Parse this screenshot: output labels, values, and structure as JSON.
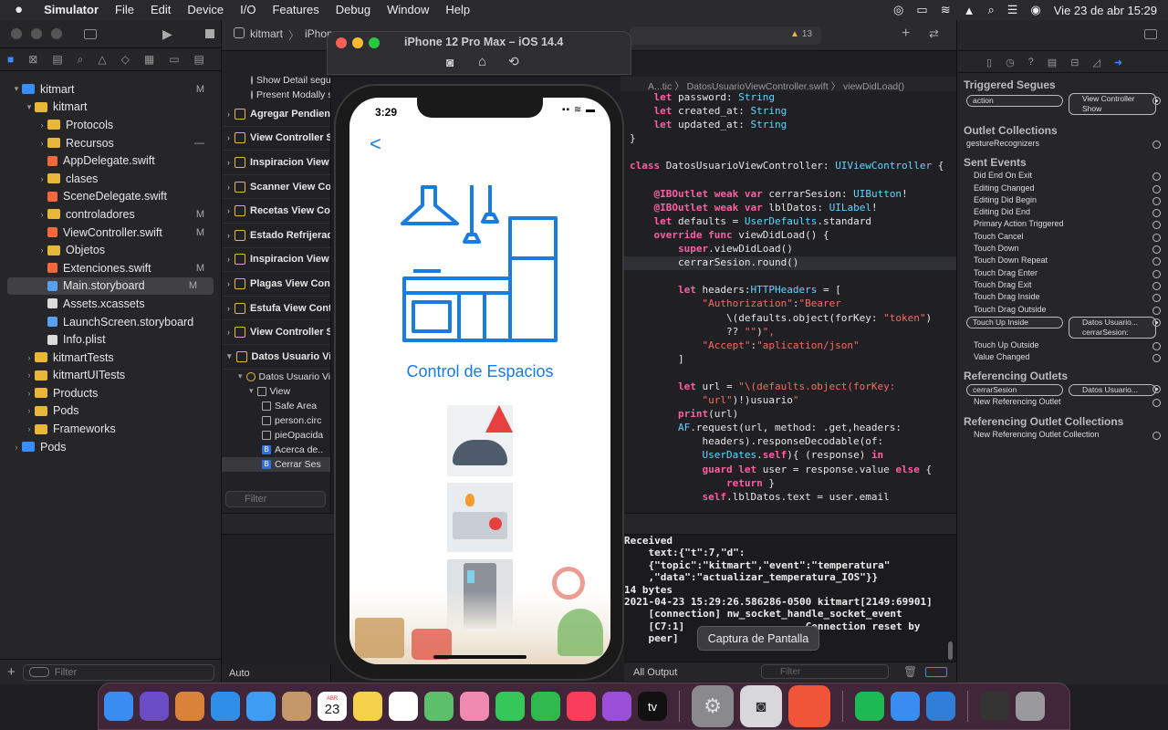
{
  "menubar": {
    "app": "Simulator",
    "items": [
      "File",
      "Edit",
      "Device",
      "I/O",
      "Features",
      "Debug",
      "Window",
      "Help"
    ],
    "datetime": "Vie 23 de abr  15:29"
  },
  "xcode": {
    "scheme": "kitmart",
    "scheme_dest": "iPhon",
    "warnings": "13",
    "storyboard_tab": "Ma",
    "breadcrumb_left": "kitmart",
    "breadcrumb_right": "A...tic",
    "breadcrumb_file": "DatosUsuarioViewController.swift",
    "breadcrumb_method": "viewDidLoad()",
    "nav_filter_placeholder": "Filter",
    "outline_filter_placeholder": "Filter",
    "zoom": "Auto",
    "console_filter": "All Output",
    "console_filter_placeholder": "Filter"
  },
  "navigator": {
    "tree": [
      {
        "label": "kitmart",
        "badge": "M",
        "level": 0,
        "icon": "project"
      },
      {
        "label": "kitmart",
        "badge": "",
        "level": 1,
        "icon": "folder"
      },
      {
        "label": "Protocols",
        "badge": "",
        "level": 2,
        "icon": "folder"
      },
      {
        "label": "Recursos",
        "badge": "—",
        "level": 2,
        "icon": "folder"
      },
      {
        "label": "AppDelegate.swift",
        "badge": "",
        "level": 2,
        "icon": "swift"
      },
      {
        "label": "clases",
        "badge": "",
        "level": 2,
        "icon": "folder"
      },
      {
        "label": "SceneDelegate.swift",
        "badge": "",
        "level": 2,
        "icon": "swift"
      },
      {
        "label": "controladores",
        "badge": "M",
        "level": 2,
        "icon": "folder"
      },
      {
        "label": "ViewController.swift",
        "badge": "M",
        "level": 2,
        "icon": "swift"
      },
      {
        "label": "Objetos",
        "badge": "",
        "level": 2,
        "icon": "folder"
      },
      {
        "label": "Extenciones.swift",
        "badge": "M",
        "level": 2,
        "icon": "swift"
      },
      {
        "label": "Main.storyboard",
        "badge": "M",
        "level": 2,
        "icon": "storyboard"
      },
      {
        "label": "Assets.xcassets",
        "badge": "",
        "level": 2,
        "icon": "file"
      },
      {
        "label": "LaunchScreen.storyboard",
        "badge": "",
        "level": 2,
        "icon": "storyboard"
      },
      {
        "label": "Info.plist",
        "badge": "",
        "level": 2,
        "icon": "file"
      },
      {
        "label": "kitmartTests",
        "badge": "",
        "level": 1,
        "icon": "folder"
      },
      {
        "label": "kitmartUITests",
        "badge": "",
        "level": 1,
        "icon": "folder"
      },
      {
        "label": "Products",
        "badge": "",
        "level": 1,
        "icon": "folder"
      },
      {
        "label": "Pods",
        "badge": "",
        "level": 1,
        "icon": "folder"
      },
      {
        "label": "Frameworks",
        "badge": "",
        "level": 1,
        "icon": "folder"
      },
      {
        "label": "Pods",
        "badge": "",
        "level": 0,
        "icon": "project"
      }
    ]
  },
  "outline": {
    "top_items": [
      "Show Detail segue to...",
      "Present Modally se..."
    ],
    "scenes": [
      "Agregar Pendientes",
      "View Controller Sc",
      "Inspiracion View Co",
      "Scanner View Con",
      "Recetas View Con",
      "Estado Refrijerado",
      "Inspiracion View Co",
      "Plagas View Contro",
      "Estufa View Contro",
      "View Controller Sc",
      "Datos Usuario View"
    ],
    "sub": [
      {
        "label": "Datos Usuario Vi",
        "kind": "vc"
      },
      {
        "label": "View",
        "kind": "view"
      },
      {
        "label": "Safe Area",
        "kind": "area"
      },
      {
        "label": "person.circ",
        "kind": "img"
      },
      {
        "label": "pieOpacida",
        "kind": "img"
      },
      {
        "label": "Acerca de..",
        "kind": "btn"
      },
      {
        "label": "Cerrar Ses",
        "kind": "btn"
      }
    ]
  },
  "simulator": {
    "title": "iPhone 12 Pro Max – iOS 14.4",
    "time": "3:29",
    "back": "<",
    "heading": "Control de Espacios"
  },
  "code": [
    "    let password: String",
    "    let created_at: String",
    "    let updated_at: String",
    "}",
    "",
    "class DatosUsuarioViewController: UIViewController {",
    "",
    "    @IBOutlet weak var cerrarSesion: UIButton!",
    "    @IBOutlet weak var lblDatos: UILabel!",
    "    let defaults = UserDefaults.standard",
    "    override func viewDidLoad() {",
    "        super.viewDidLoad()",
    "        cerrarSesion.round()",
    "",
    "        let headers:HTTPHeaders = [",
    "            \"Authorization\":\"Bearer",
    "                \\(defaults.object(forKey: \"token\")",
    "                ?? \"\")\",",
    "            \"Accept\":\"aplication/json\"",
    "        ]",
    "",
    "        let url = \"\\(defaults.object(forKey:",
    "            \"url\")!)usuario\"",
    "        print(url)",
    "        AF.request(url, method: .get,headers:",
    "            headers).responseDecodable(of:",
    "            UserDates.self){ (response) in",
    "            guard let user = response.value else {",
    "                return }",
    "            self.lblDatos.text = user.email"
  ],
  "console": [
    "Received",
    "    text:{\"t\":7,\"d\":",
    "    {\"topic\":\"kitmart\",\"event\":\"temperatura\"",
    "    ,\"data\":\"actualizar_temperatura_IOS\"}}",
    "14 bytes",
    "2021-04-23 15:29:26.586286-0500 kitmart[2149:69901]",
    "    [connection] nw_socket_handle_socket_event",
    "    [C7:1]                    Connection reset by",
    "    peer]"
  ],
  "inspector": {
    "triggered_segues": "Triggered Segues",
    "segue_action": "action",
    "segue_target_1": "View Controller",
    "segue_target_2": "Show",
    "outlet_collections": "Outlet Collections",
    "gesture": "gestureRecognizers",
    "sent_events": "Sent Events",
    "events": [
      "Did End On Exit",
      "Editing Changed",
      "Editing Did Begin",
      "Editing Did End",
      "Primary Action Triggered",
      "Touch Cancel",
      "Touch Down",
      "Touch Down Repeat",
      "Touch Drag Enter",
      "Touch Drag Exit",
      "Touch Drag Inside",
      "Touch Drag Outside",
      "Touch Up Inside",
      "Touch Up Outside",
      "Value Changed"
    ],
    "tui_target_1": "Datos Usuario...",
    "tui_target_2": "cerrarSesion:",
    "referencing_outlets": "Referencing Outlets",
    "ref_outlet": "cerrarSesion",
    "ref_target": "Datos Usuario...",
    "new_ref_outlet": "New Referencing Outlet",
    "referencing_collections": "Referencing Outlet Collections",
    "new_ref_collection": "New Referencing Outlet Collection"
  },
  "tooltip": "Captura de Pantalla",
  "dock": {
    "icons": [
      {
        "name": "finder-icon",
        "color": "#3a8df0"
      },
      {
        "name": "siri-icon",
        "color": "#6a4cc6"
      },
      {
        "name": "launchpad-icon",
        "color": "#d9823a"
      },
      {
        "name": "safari-icon",
        "color": "#2f8fe8"
      },
      {
        "name": "mail-icon",
        "color": "#3e9cf2"
      },
      {
        "name": "contacts-icon",
        "color": "#c4976a"
      },
      {
        "name": "calendar-icon",
        "color": "#ffffff"
      },
      {
        "name": "notes-icon",
        "color": "#f5d04a"
      },
      {
        "name": "reminders-icon",
        "color": "#ffffff"
      },
      {
        "name": "maps-icon",
        "color": "#5cbf6a"
      },
      {
        "name": "photos-icon",
        "color": "#f08ab0"
      },
      {
        "name": "messages-icon",
        "color": "#35c759"
      },
      {
        "name": "facetime-icon",
        "color": "#30b94e"
      },
      {
        "name": "music-icon",
        "color": "#fa3d5a"
      },
      {
        "name": "podcasts-icon",
        "color": "#9b4fd8"
      },
      {
        "name": "appletv-icon",
        "color": "#111111"
      },
      {
        "name": "system-preferences-icon",
        "color": "#8a8a8e"
      },
      {
        "name": "screenshot-icon",
        "color": "#d8d8dc"
      },
      {
        "name": "brave-icon",
        "color": "#f0553a"
      },
      {
        "name": "spotify-icon",
        "color": "#1db954"
      },
      {
        "name": "xcode-icon",
        "color": "#3a8df0"
      },
      {
        "name": "xcode-beta-icon",
        "color": "#2f7ed8"
      },
      {
        "name": "activity-monitor-icon",
        "color": "#333333"
      },
      {
        "name": "trash-icon",
        "color": "#9a9a9e"
      }
    ],
    "calendar_month": "ABR",
    "calendar_day": "23",
    "tv_label": "tv"
  }
}
